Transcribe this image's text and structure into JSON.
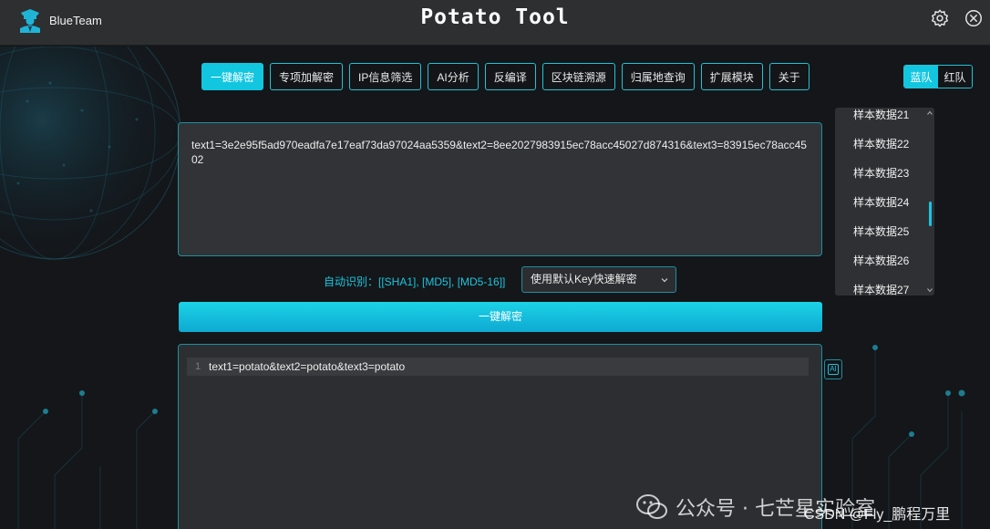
{
  "app": {
    "brand_name": "BlueTeam",
    "title": "Potato Tool"
  },
  "colors": {
    "accent": "#12c6e0",
    "panel": "#323337",
    "background": "#141619",
    "titlebar": "#2e2f31"
  },
  "icons": {
    "brand": "agent-avatar-icon",
    "settings": "gear-icon",
    "close": "close-icon",
    "ai": "ai-icon",
    "watermark": "wechat-icon"
  },
  "tabs": [
    {
      "label": "一键解密",
      "active": true
    },
    {
      "label": "专项加解密",
      "active": false
    },
    {
      "label": "IP信息筛选",
      "active": false
    },
    {
      "label": "AI分析",
      "active": false
    },
    {
      "label": "反编译",
      "active": false
    },
    {
      "label": "区块链溯源",
      "active": false
    },
    {
      "label": "归属地查询",
      "active": false
    },
    {
      "label": "扩展模块",
      "active": false
    },
    {
      "label": "关于",
      "active": false
    }
  ],
  "team_toggle": {
    "blue": "蓝队",
    "red": "红队",
    "active": "blue"
  },
  "input": {
    "text": "text1=3e2e95f5ad970eadfa7e17eaf73da97024aa5359&text2=8ee2027983915ec78acc45027d874316&text3=83915ec78acc4502"
  },
  "samples": {
    "items": [
      "样本数据21",
      "样本数据22",
      "样本数据23",
      "样本数据24",
      "样本数据25",
      "样本数据26",
      "样本数据27"
    ]
  },
  "detect": {
    "label": "自动识别：[[SHA1], [MD5], [MD5-16]]"
  },
  "key_select": {
    "selected": "使用默认Key快速解密"
  },
  "decode_button": {
    "label": "一键解密"
  },
  "output": {
    "line_number": "1",
    "text": "text1=potato&text2=potato&text3=potato",
    "ai_label": "AI"
  },
  "watermark": {
    "text": "公众号 · 七芒星实验室",
    "csdn": "CSDN @Fly_鹏程万里"
  }
}
